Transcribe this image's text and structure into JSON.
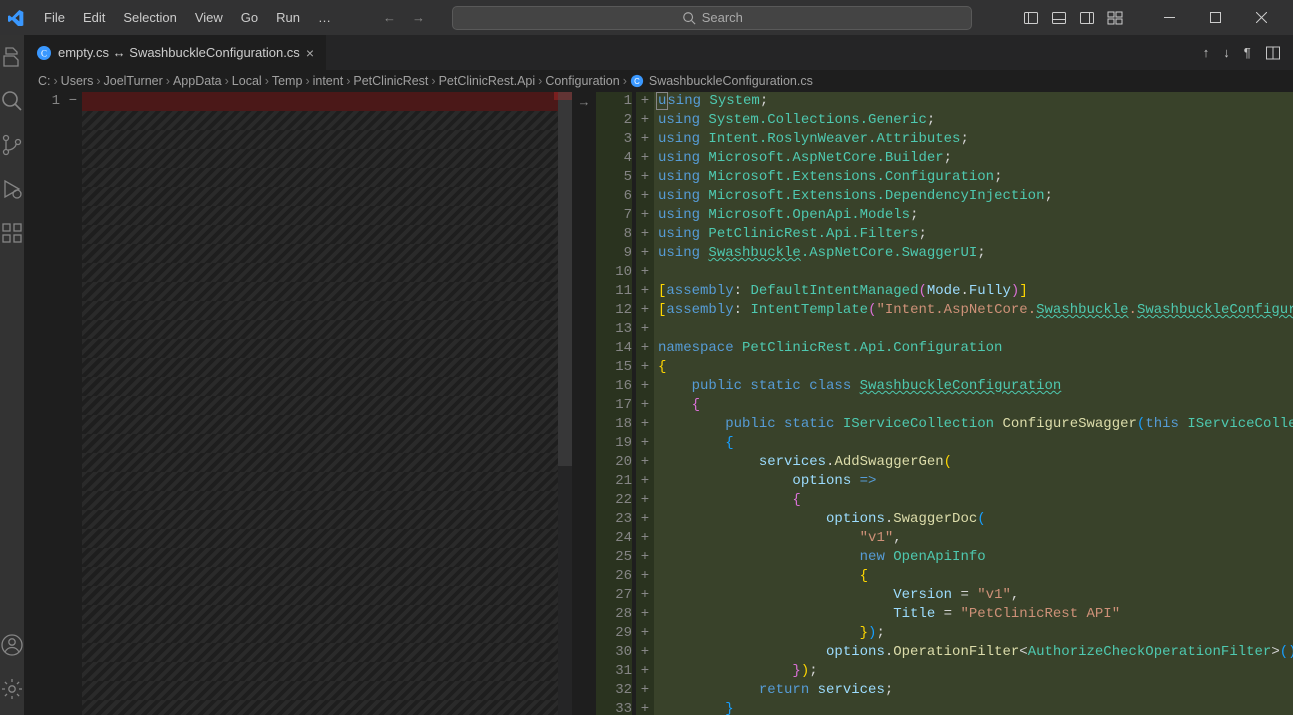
{
  "menu": [
    "File",
    "Edit",
    "Selection",
    "View",
    "Go",
    "Run",
    "…"
  ],
  "search_placeholder": "Search",
  "tab_label": "empty.cs ↔ SwashbuckleConfiguration.cs",
  "breadcrumb": [
    "C:",
    "Users",
    "JoelTurner",
    "AppData",
    "Local",
    "Temp",
    "intent",
    "PetClinicRest",
    "PetClinicRest.Api",
    "Configuration"
  ],
  "breadcrumb_file": "SwashbuckleConfiguration.cs",
  "left_lines": {
    "count": 1
  },
  "right_lines": [
    {
      "n": 1,
      "tokens": [
        [
          "kw",
          "using "
        ],
        [
          "ns",
          "System"
        ],
        [
          "pun",
          ";"
        ]
      ]
    },
    {
      "n": 2,
      "tokens": [
        [
          "kw",
          "using "
        ],
        [
          "ns",
          "System.Collections.Generic"
        ],
        [
          "pun",
          ";"
        ]
      ]
    },
    {
      "n": 3,
      "tokens": [
        [
          "kw",
          "using "
        ],
        [
          "ns",
          "Intent.RoslynWeaver.Attributes"
        ],
        [
          "pun",
          ";"
        ]
      ]
    },
    {
      "n": 4,
      "tokens": [
        [
          "kw",
          "using "
        ],
        [
          "ns",
          "Microsoft.AspNetCore.Builder"
        ],
        [
          "pun",
          ";"
        ]
      ]
    },
    {
      "n": 5,
      "tokens": [
        [
          "kw",
          "using "
        ],
        [
          "ns",
          "Microsoft.Extensions.Configuration"
        ],
        [
          "pun",
          ";"
        ]
      ]
    },
    {
      "n": 6,
      "tokens": [
        [
          "kw",
          "using "
        ],
        [
          "ns",
          "Microsoft.Extensions.DependencyInjection"
        ],
        [
          "pun",
          ";"
        ]
      ]
    },
    {
      "n": 7,
      "tokens": [
        [
          "kw",
          "using "
        ],
        [
          "ns",
          "Microsoft.OpenApi.Models"
        ],
        [
          "pun",
          ";"
        ]
      ]
    },
    {
      "n": 8,
      "tokens": [
        [
          "kw",
          "using "
        ],
        [
          "ns",
          "PetClinicRest.Api.Filters"
        ],
        [
          "pun",
          ";"
        ]
      ]
    },
    {
      "n": 9,
      "tokens": [
        [
          "kw",
          "using "
        ],
        [
          "wavy",
          "Swashbuckle"
        ],
        [
          "ns",
          ".AspNetCore.SwaggerUI"
        ],
        [
          "pun",
          ";"
        ]
      ]
    },
    {
      "n": 10,
      "tokens": []
    },
    {
      "n": 11,
      "tokens": [
        [
          "br",
          "["
        ],
        [
          "kw",
          "assembly"
        ],
        [
          "pun",
          ": "
        ],
        [
          "cls",
          "DefaultIntentManaged"
        ],
        [
          "br2",
          "("
        ],
        [
          "var",
          "Mode"
        ],
        [
          "pun",
          "."
        ],
        [
          "var",
          "Fully"
        ],
        [
          "br2",
          ")"
        ],
        [
          "br",
          "]"
        ]
      ]
    },
    {
      "n": 12,
      "tokens": [
        [
          "br",
          "["
        ],
        [
          "kw",
          "assembly"
        ],
        [
          "pun",
          ": "
        ],
        [
          "cls",
          "IntentTemplate"
        ],
        [
          "br2",
          "("
        ],
        [
          "str",
          "\"Intent.AspNetCore."
        ],
        [
          "wavy",
          "Swashbuckle"
        ],
        [
          "str",
          "."
        ],
        [
          "wavy",
          "SwashbuckleConfigurati"
        ]
      ]
    },
    {
      "n": 13,
      "tokens": []
    },
    {
      "n": 14,
      "tokens": [
        [
          "kw",
          "namespace "
        ],
        [
          "ns",
          "PetClinicRest.Api.Configuration"
        ]
      ]
    },
    {
      "n": 15,
      "tokens": [
        [
          "br",
          "{"
        ]
      ]
    },
    {
      "n": 16,
      "indent": 1,
      "tokens": [
        [
          "kw",
          "public static class "
        ],
        [
          "wavy",
          "SwashbuckleConfiguration"
        ]
      ]
    },
    {
      "n": 17,
      "indent": 1,
      "tokens": [
        [
          "br2",
          "{"
        ]
      ]
    },
    {
      "n": 18,
      "indent": 2,
      "tokens": [
        [
          "kw",
          "public static "
        ],
        [
          "cls",
          "IServiceCollection "
        ],
        [
          "fn",
          "ConfigureSwagger"
        ],
        [
          "br3",
          "("
        ],
        [
          "kw",
          "this "
        ],
        [
          "cls",
          "IServiceCollecti"
        ]
      ]
    },
    {
      "n": 19,
      "indent": 2,
      "tokens": [
        [
          "br3",
          "{"
        ]
      ]
    },
    {
      "n": 20,
      "indent": 3,
      "tokens": [
        [
          "var",
          "services"
        ],
        [
          "pun",
          "."
        ],
        [
          "fn",
          "AddSwaggerGen"
        ],
        [
          "br",
          "("
        ]
      ]
    },
    {
      "n": 21,
      "indent": 4,
      "tokens": [
        [
          "var",
          "options "
        ],
        [
          "kw",
          "=>"
        ]
      ]
    },
    {
      "n": 22,
      "indent": 4,
      "tokens": [
        [
          "br2",
          "{"
        ]
      ]
    },
    {
      "n": 23,
      "indent": 5,
      "tokens": [
        [
          "var",
          "options"
        ],
        [
          "pun",
          "."
        ],
        [
          "fn",
          "SwaggerDoc"
        ],
        [
          "br3",
          "("
        ]
      ]
    },
    {
      "n": 24,
      "indent": 6,
      "tokens": [
        [
          "str",
          "\"v1\""
        ],
        [
          "pun",
          ","
        ]
      ]
    },
    {
      "n": 25,
      "indent": 6,
      "tokens": [
        [
          "kw",
          "new "
        ],
        [
          "cls",
          "OpenApiInfo"
        ]
      ]
    },
    {
      "n": 26,
      "indent": 6,
      "tokens": [
        [
          "br",
          "{"
        ]
      ]
    },
    {
      "n": 27,
      "indent": 7,
      "tokens": [
        [
          "var",
          "Version "
        ],
        [
          "pun",
          "= "
        ],
        [
          "str",
          "\"v1\""
        ],
        [
          "pun",
          ","
        ]
      ]
    },
    {
      "n": 28,
      "indent": 7,
      "tokens": [
        [
          "var",
          "Title "
        ],
        [
          "pun",
          "= "
        ],
        [
          "str",
          "\"PetClinicRest API\""
        ]
      ]
    },
    {
      "n": 29,
      "indent": 6,
      "tokens": [
        [
          "br",
          "}"
        ],
        [
          "br3",
          ")"
        ],
        [
          "pun",
          ";"
        ]
      ]
    },
    {
      "n": 30,
      "indent": 5,
      "tokens": [
        [
          "var",
          "options"
        ],
        [
          "pun",
          "."
        ],
        [
          "fn",
          "OperationFilter"
        ],
        [
          "pun",
          "<"
        ],
        [
          "cls",
          "AuthorizeCheckOperationFilter"
        ],
        [
          "pun",
          ">"
        ],
        [
          "br3",
          "("
        ],
        [
          "br3",
          ")"
        ],
        [
          "pun",
          ";"
        ]
      ]
    },
    {
      "n": 31,
      "indent": 4,
      "tokens": [
        [
          "br2",
          "}"
        ],
        [
          "br",
          ")"
        ],
        [
          "pun",
          ";"
        ]
      ]
    },
    {
      "n": 32,
      "indent": 3,
      "tokens": [
        [
          "kw",
          "return "
        ],
        [
          "var",
          "services"
        ],
        [
          "pun",
          ";"
        ]
      ]
    },
    {
      "n": 33,
      "indent": 2,
      "tokens": [
        [
          "br3",
          "}"
        ]
      ]
    }
  ]
}
